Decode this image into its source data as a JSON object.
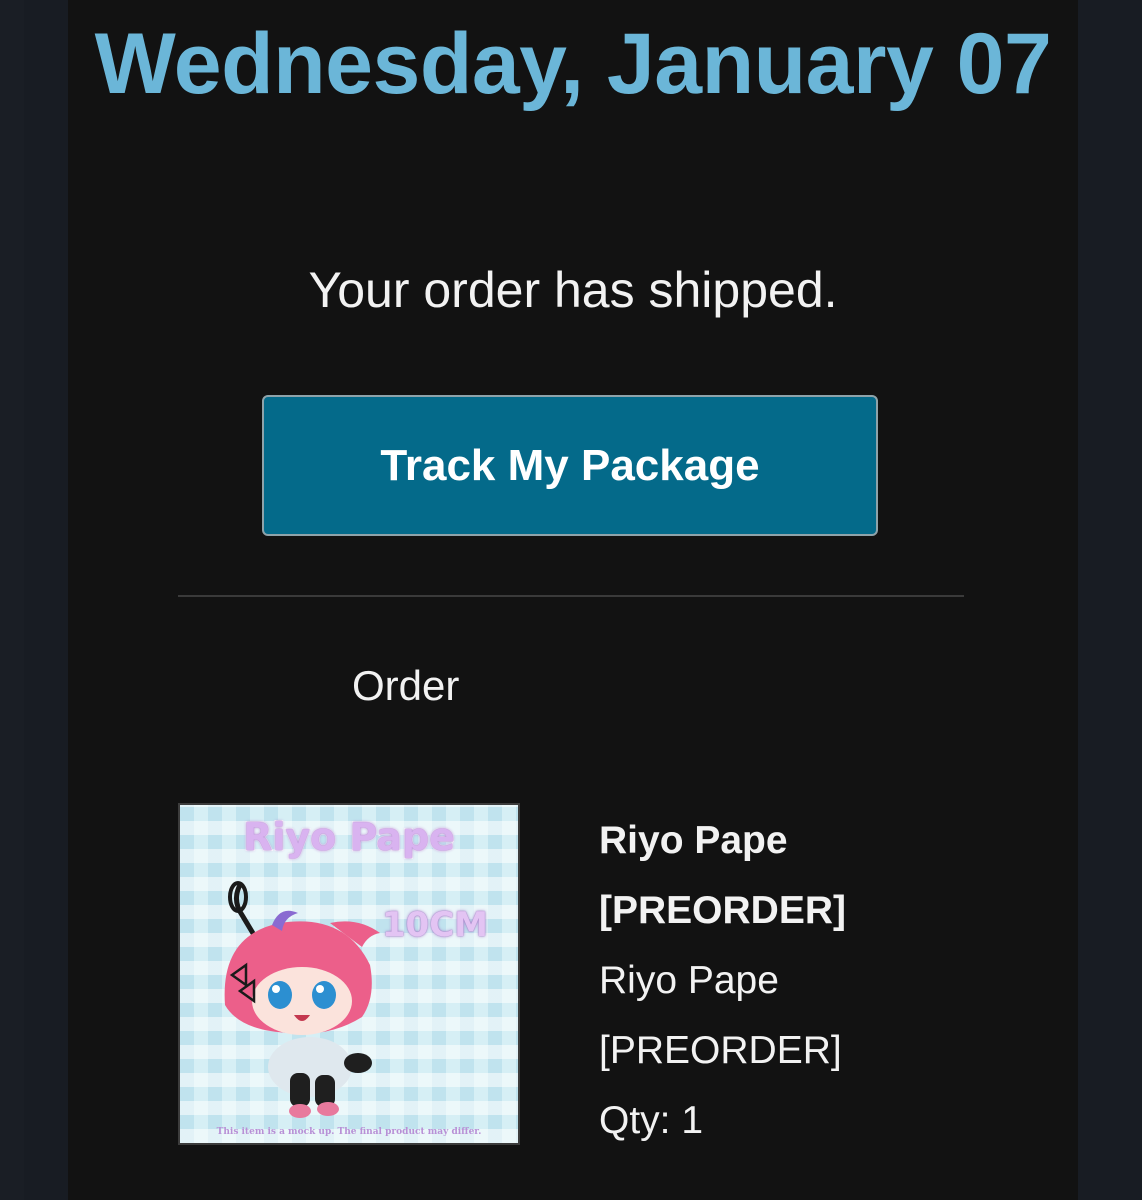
{
  "email": {
    "date_heading": "Wednesday, January 07",
    "message": "Your order has shipped.",
    "track_button_label": "Track My Package",
    "order_section_label": "Order"
  },
  "product": {
    "name": "Riyo Pape [PREORDER]",
    "variant": "Riyo Pape [PREORDER]",
    "quantity": "Qty: 1",
    "image": {
      "title_text": "Riyo Pape",
      "size_text": "10CM",
      "disclaimer_text": "This item is a mock up. The final product may differ.",
      "background_color": "#d6eff5"
    }
  },
  "colors": {
    "heading": "#6bb6d8",
    "button_bg": "#046a8a",
    "background": "#121212",
    "text": "#f2f2f2"
  }
}
